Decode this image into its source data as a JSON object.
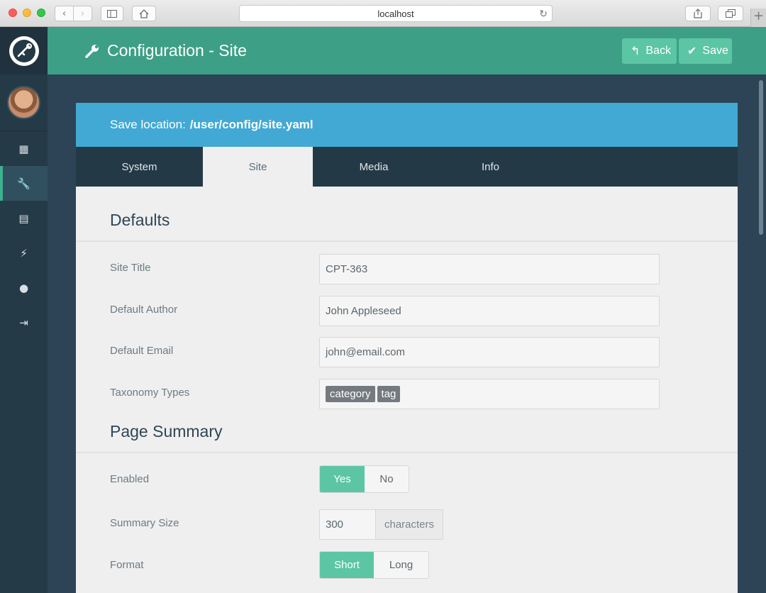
{
  "browser": {
    "url": "localhost",
    "icons": {
      "back": "chevron-left-icon",
      "forward": "chevron-right-icon",
      "sidebar": "sidebar-icon",
      "home": "home-icon",
      "reload": "reload-icon",
      "share": "share-icon",
      "tabs": "tabs-icon",
      "new_tab": "plus-icon"
    }
  },
  "sidebar": {
    "items": [
      {
        "icon": "dashboard-grid-icon",
        "glyph": "▦",
        "active": false
      },
      {
        "icon": "wrench-icon",
        "glyph": "🔧",
        "active": true
      },
      {
        "icon": "pages-icon",
        "glyph": "▤",
        "active": false
      },
      {
        "icon": "plugin-icon",
        "glyph": "⚡",
        "active": false
      },
      {
        "icon": "theme-drop-icon",
        "glyph": "●",
        "active": false
      },
      {
        "icon": "logout-icon",
        "glyph": "⇥",
        "active": false
      }
    ]
  },
  "header": {
    "title": "Configuration - Site",
    "back_label": "Back",
    "save_label": "Save"
  },
  "save_location": {
    "prefix": "Save location:",
    "path": "/user/config/site.yaml"
  },
  "tabs": [
    {
      "label": "System",
      "active": false
    },
    {
      "label": "Site",
      "active": true
    },
    {
      "label": "Media",
      "active": false
    },
    {
      "label": "Info",
      "active": false
    }
  ],
  "defaults": {
    "title": "Defaults",
    "site_title_label": "Site Title",
    "site_title_value": "CPT-363",
    "author_label": "Default Author",
    "author_value": "John Appleseed",
    "email_label": "Default Email",
    "email_value": "john@email.com",
    "taxonomy_label": "Taxonomy Types",
    "taxonomy_tags": [
      "category",
      "tag"
    ]
  },
  "page_summary": {
    "title": "Page Summary",
    "enabled_label": "Enabled",
    "enabled_yes": "Yes",
    "enabled_no": "No",
    "size_label": "Summary Size",
    "size_value": "300",
    "size_unit": "characters",
    "format_label": "Format",
    "format_short": "Short",
    "format_long": "Long"
  },
  "colors": {
    "accent": "#3d9f85",
    "button": "#5cc5a4",
    "info_bar": "#42a9d4",
    "sidebar": "#253a47"
  }
}
